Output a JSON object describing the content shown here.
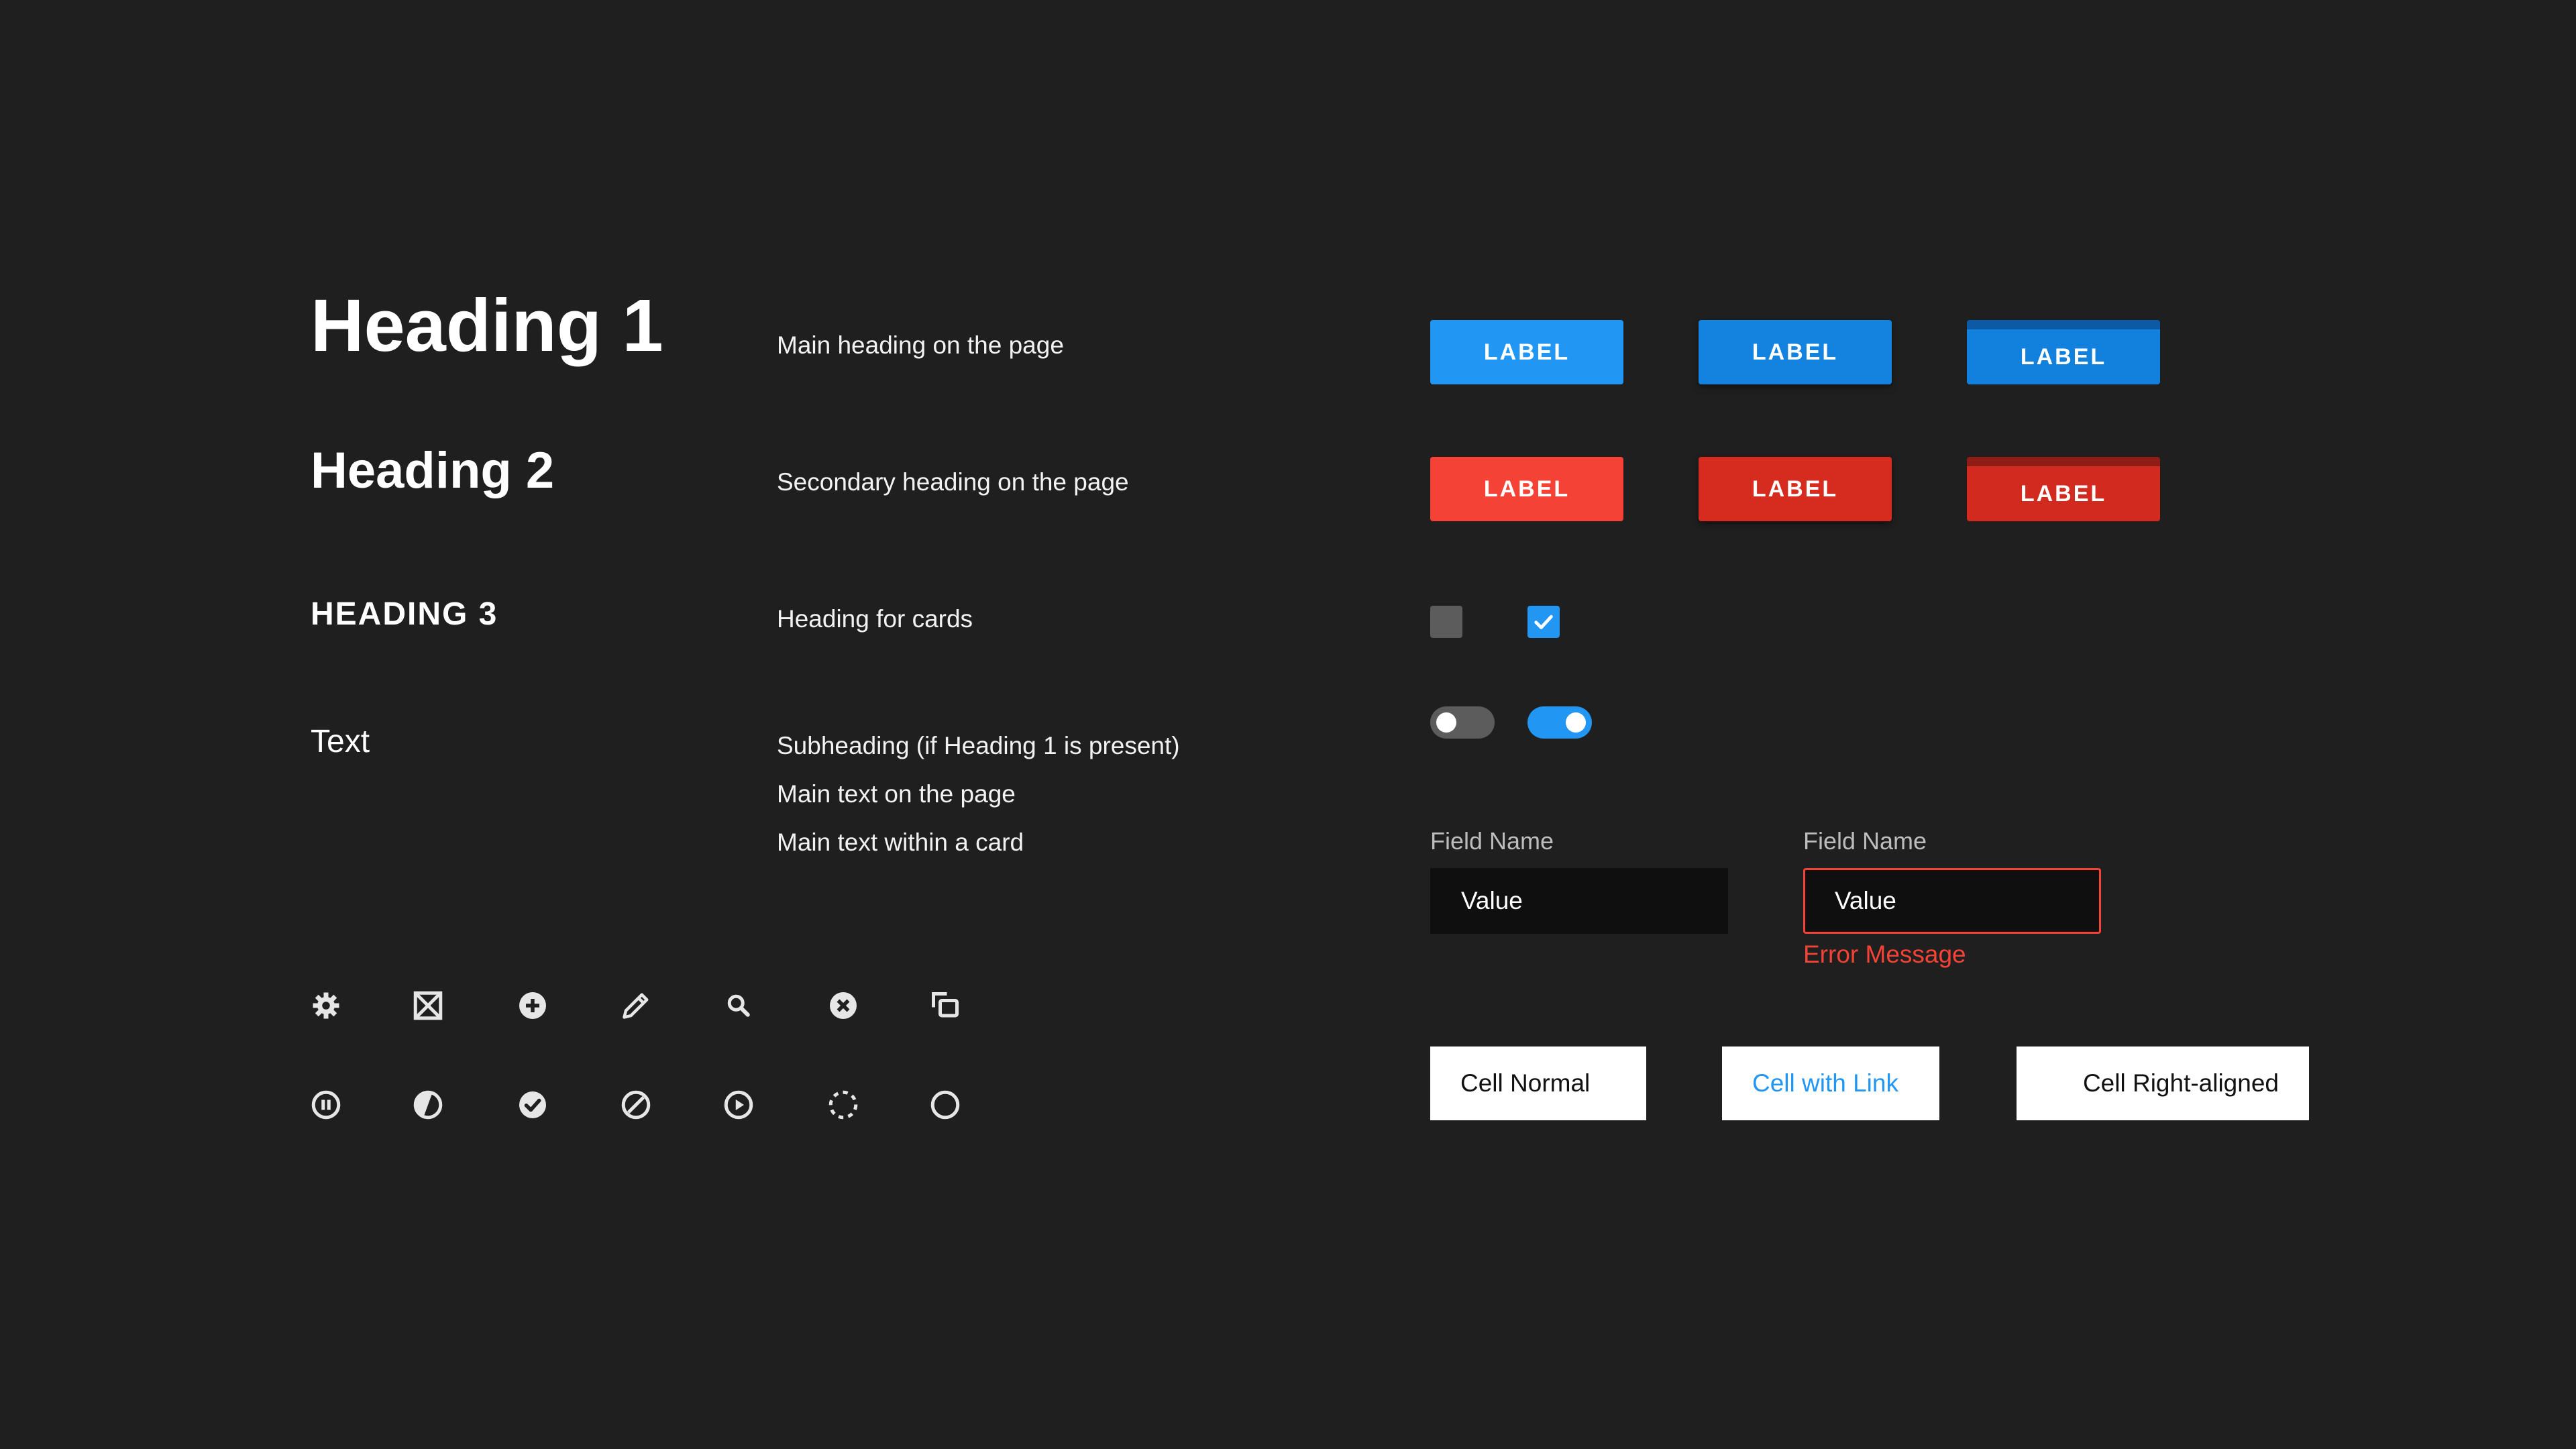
{
  "typography": {
    "heading1": "Heading 1",
    "heading2": "Heading 2",
    "heading3": "HEADING 3",
    "text": "Text"
  },
  "descriptions": {
    "heading1": "Main heading on the page",
    "heading2": "Secondary heading on the page",
    "heading3": "Heading for cards",
    "text": [
      "Subheading (if Heading 1 is present)",
      "Main text on the page",
      "Main text within a card"
    ]
  },
  "buttons": {
    "primary": [
      "LABEL",
      "LABEL",
      "LABEL"
    ],
    "danger": [
      "LABEL",
      "LABEL",
      "LABEL"
    ]
  },
  "checkboxes": [
    {
      "checked": false
    },
    {
      "checked": true
    }
  ],
  "toggles": [
    {
      "on": false
    },
    {
      "on": true
    }
  ],
  "fields": [
    {
      "label": "Field Name",
      "value": "Value",
      "error": ""
    },
    {
      "label": "Field Name",
      "value": "Value",
      "error": "Error Message"
    }
  ],
  "cells": {
    "normal": "Cell Normal",
    "link": "Cell with Link",
    "right": "Cell Right-aligned"
  },
  "icons": {
    "row1": [
      "gear-icon",
      "close-box-icon",
      "add-circle-icon",
      "pencil-icon",
      "search-icon",
      "close-circle-icon",
      "copy-icon"
    ],
    "row2": [
      "pause-circle-icon",
      "half-circle-icon",
      "check-circle-icon",
      "block-icon",
      "play-circle-icon",
      "dashed-circle-icon",
      "empty-circle-icon"
    ]
  },
  "colors": {
    "background": "#1f1f1f",
    "primary": "#2196f3",
    "danger": "#f44336",
    "neutral": "#5c5c5c"
  }
}
